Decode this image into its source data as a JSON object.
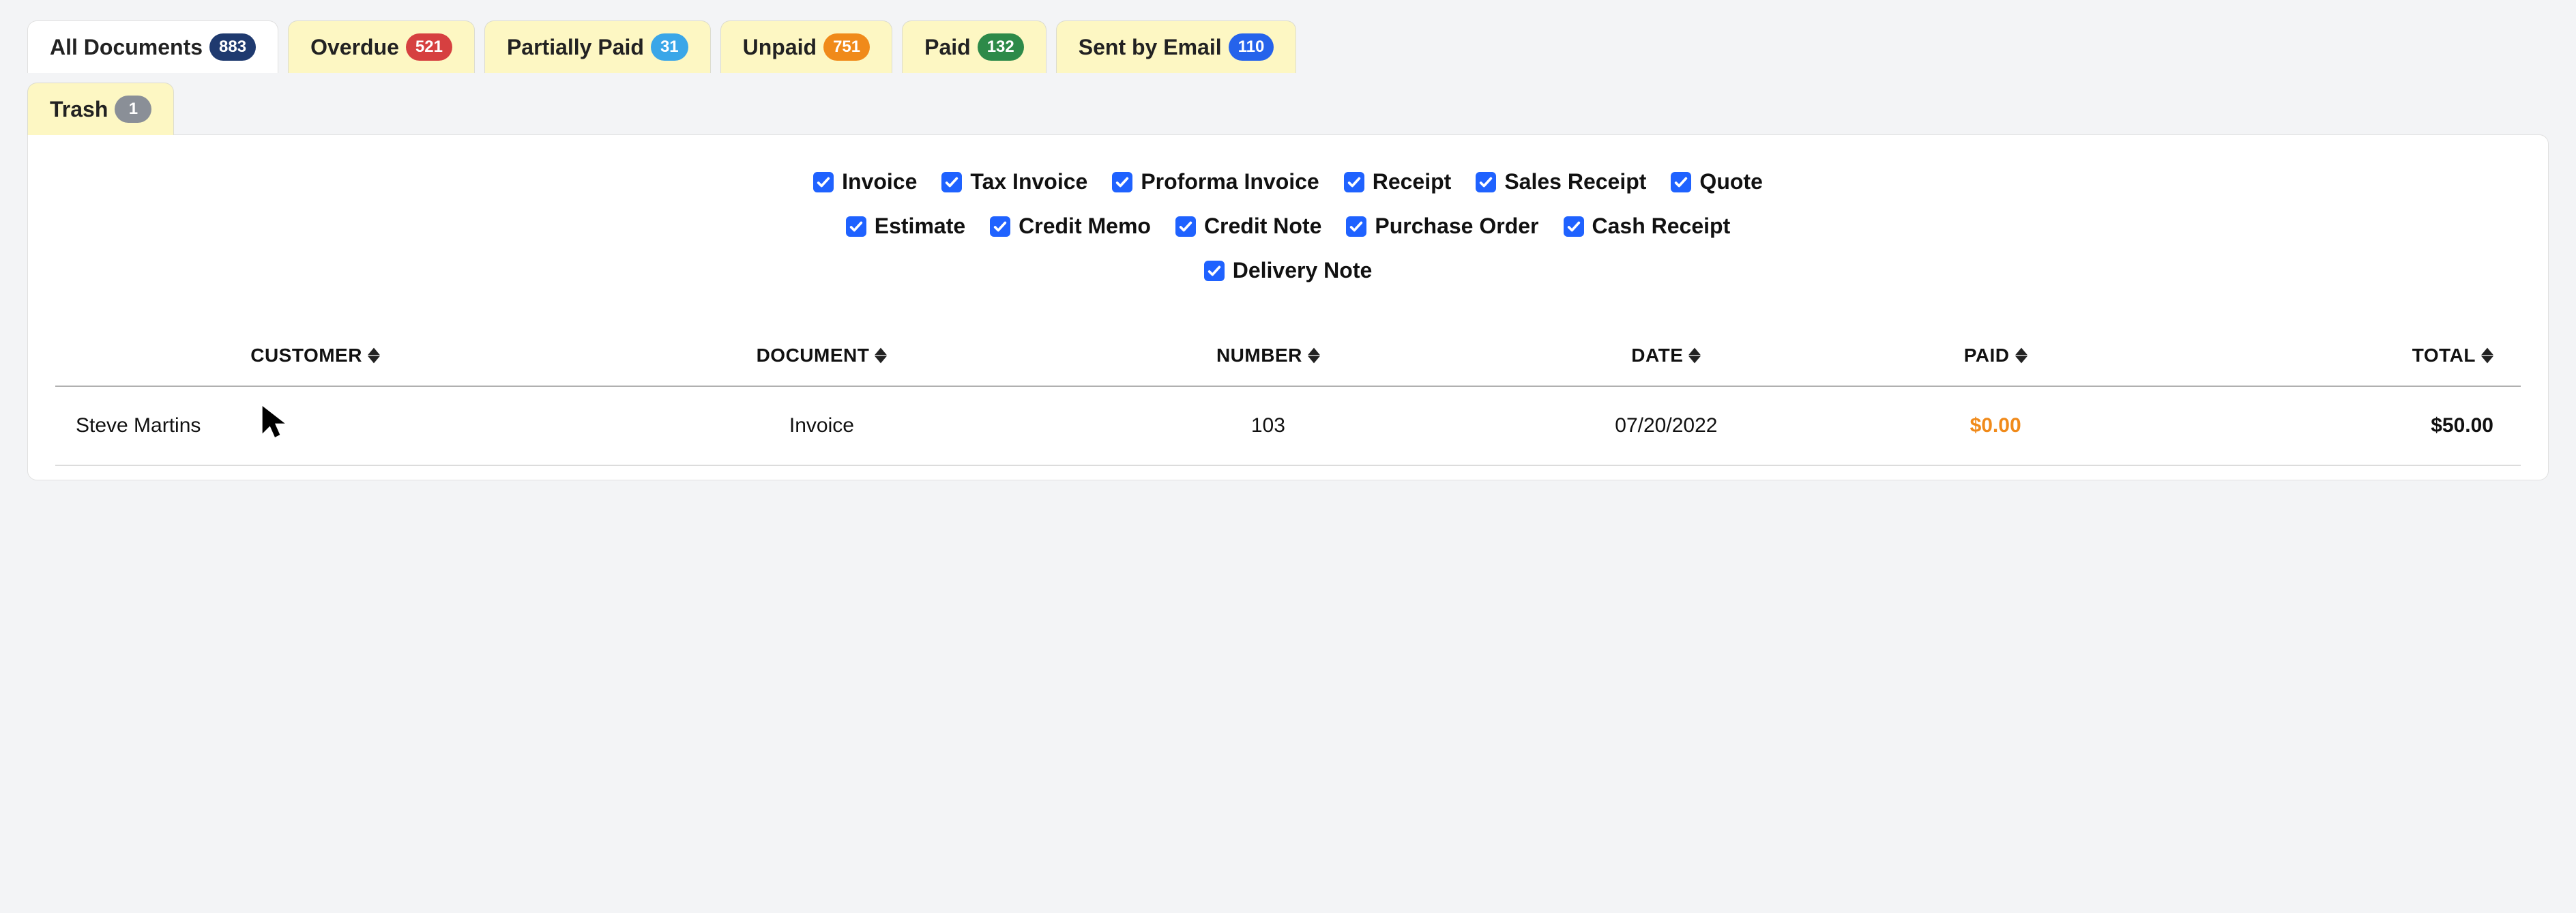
{
  "tabs_row1": [
    {
      "label": "All Documents",
      "count": "883",
      "badge": "badge-navy",
      "active": true,
      "name": "tab-all-documents"
    },
    {
      "label": "Overdue",
      "count": "521",
      "badge": "badge-red",
      "active": false,
      "name": "tab-overdue"
    },
    {
      "label": "Partially Paid",
      "count": "31",
      "badge": "badge-sky",
      "active": false,
      "name": "tab-partially-paid"
    },
    {
      "label": "Unpaid",
      "count": "751",
      "badge": "badge-orange",
      "active": false,
      "name": "tab-unpaid"
    },
    {
      "label": "Paid",
      "count": "132",
      "badge": "badge-green",
      "active": false,
      "name": "tab-paid"
    },
    {
      "label": "Sent by Email",
      "count": "110",
      "badge": "badge-blue",
      "active": false,
      "name": "tab-sent-by-email"
    }
  ],
  "tabs_row2": [
    {
      "label": "Trash",
      "count": "1",
      "badge": "badge-grey",
      "active": false,
      "name": "tab-trash"
    }
  ],
  "filters": [
    {
      "label": "Invoice",
      "checked": true,
      "name": "filter-invoice"
    },
    {
      "label": "Tax Invoice",
      "checked": true,
      "name": "filter-tax-invoice"
    },
    {
      "label": "Proforma Invoice",
      "checked": true,
      "name": "filter-proforma-invoice"
    },
    {
      "label": "Receipt",
      "checked": true,
      "name": "filter-receipt"
    },
    {
      "label": "Sales Receipt",
      "checked": true,
      "name": "filter-sales-receipt"
    },
    {
      "label": "Quote",
      "checked": true,
      "name": "filter-quote"
    },
    {
      "label": "Estimate",
      "checked": true,
      "name": "filter-estimate"
    },
    {
      "label": "Credit Memo",
      "checked": true,
      "name": "filter-credit-memo"
    },
    {
      "label": "Credit Note",
      "checked": true,
      "name": "filter-credit-note"
    },
    {
      "label": "Purchase Order",
      "checked": true,
      "name": "filter-purchase-order"
    },
    {
      "label": "Cash Receipt",
      "checked": true,
      "name": "filter-cash-receipt"
    },
    {
      "label": "Delivery Note",
      "checked": true,
      "name": "filter-delivery-note"
    }
  ],
  "columns": {
    "customer": "CUSTOMER",
    "document": "DOCUMENT",
    "number": "NUMBER",
    "date": "DATE",
    "paid": "PAID",
    "total": "TOTAL"
  },
  "rows": [
    {
      "customer": "Steve Martins",
      "document": "Invoice",
      "number": "103",
      "date": "07/20/2022",
      "paid": "$0.00",
      "total": "$50.00"
    }
  ]
}
